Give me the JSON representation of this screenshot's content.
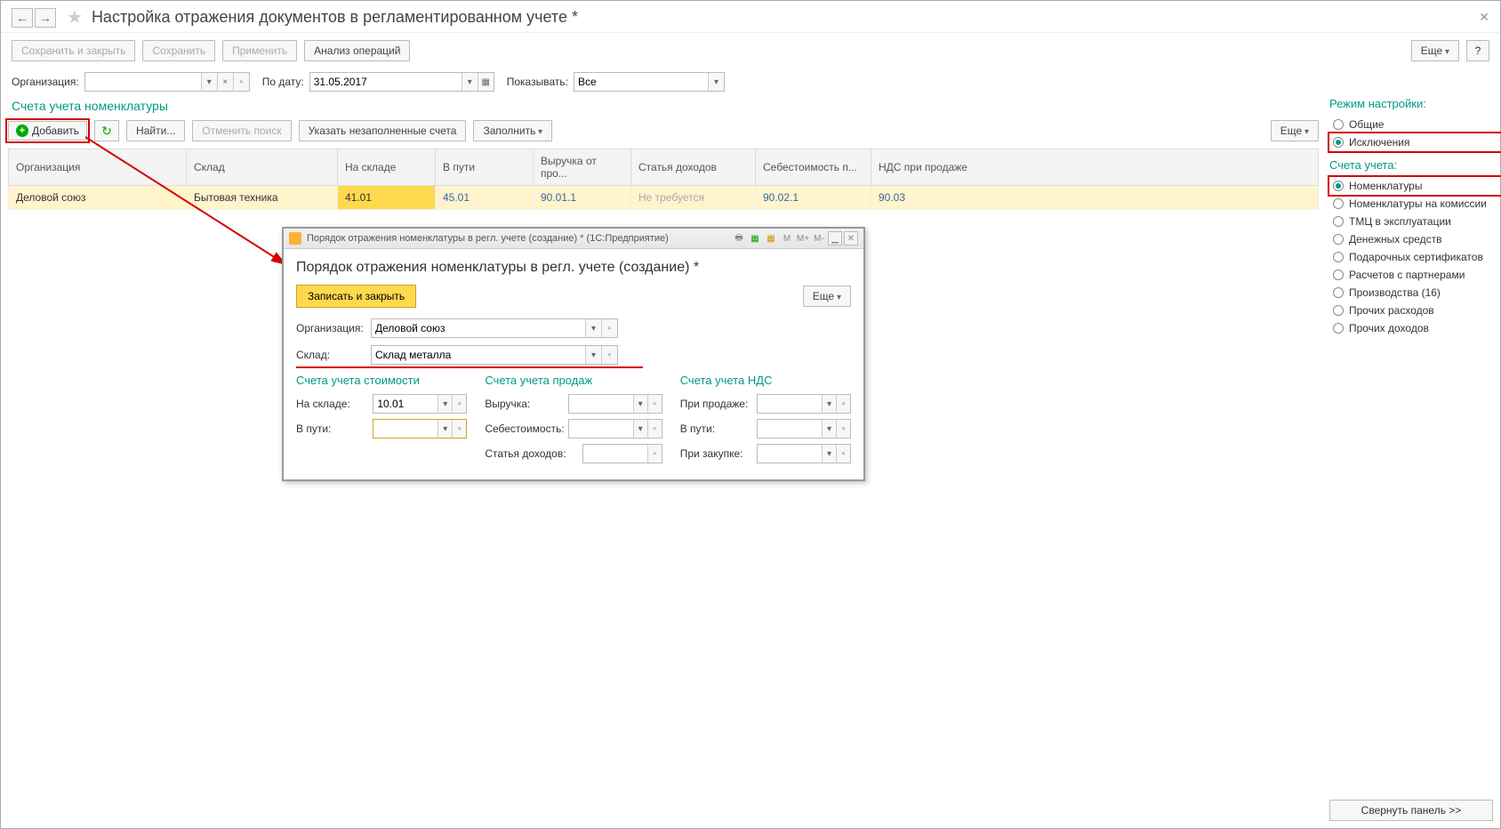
{
  "header": {
    "title": "Настройка отражения документов в регламентированном учете *"
  },
  "topToolbar": {
    "saveClose": "Сохранить и закрыть",
    "save": "Сохранить",
    "apply": "Применить",
    "analysis": "Анализ операций",
    "more": "Еще",
    "help": "?"
  },
  "filters": {
    "orgLabel": "Организация:",
    "orgValue": "",
    "dateLabel": "По дату:",
    "dateValue": "31.05.2017",
    "showLabel": "Показывать:",
    "showValue": "Все"
  },
  "section": {
    "title": "Счета учета номенклатуры",
    "add": "Добавить",
    "find": "Найти...",
    "cancelSearch": "Отменить поиск",
    "showEmpty": "Указать незаполненные счета",
    "fill": "Заполнить",
    "more": "Еще"
  },
  "table": {
    "headers": {
      "org": "Организация",
      "warehouse": "Склад",
      "atWarehouse": "На складе",
      "inTransit": "В пути",
      "revenue": "Выручка от про...",
      "incomeItem": "Статья доходов",
      "cost": "Себестоимость п...",
      "vat": "НДС при продаже"
    },
    "row": {
      "org": "Деловой союз",
      "warehouse": "Бытовая техника",
      "atWarehouse": "41.01",
      "inTransit": "45.01",
      "revenue": "90.01.1",
      "incomeItem": "Не требуется",
      "cost": "90.02.1",
      "vat": "90.03"
    }
  },
  "modal": {
    "titlebar": "Порядок отражения номенклатуры в регл. учете (создание) *  (1С:Предприятие)",
    "title": "Порядок отражения номенклатуры в регл. учете (создание) *",
    "writeClose": "Записать и закрыть",
    "more": "Еще",
    "orgLabel": "Организация:",
    "orgValue": "Деловой союз",
    "whLabel": "Склад:",
    "whValue": "Склад металла",
    "group1": "Счета учета стоимости",
    "g1_atWh": "На складе:",
    "g1_atWhVal": "10.01",
    "g1_transit": "В пути:",
    "group2": "Счета учета продаж",
    "g2_rev": "Выручка:",
    "g2_cost": "Себестоимость:",
    "g2_inc": "Статья доходов:",
    "group3": "Счета учета НДС",
    "g3_sale": "При продаже:",
    "g3_transit": "В пути:",
    "g3_purchase": "При закупке:"
  },
  "side": {
    "modeTitle": "Режим настройки:",
    "mode": {
      "common": "Общие",
      "exceptions": "Исключения"
    },
    "acctTitle": "Счета учета:",
    "accts": {
      "nomen": "Номенклатуры",
      "comm": "Номенклатуры на комиссии",
      "tmc": "ТМЦ в эксплуатации",
      "money": "Денежных средств",
      "gift": "Подарочных сертификатов",
      "partner": "Расчетов с партнерами",
      "prod": "Производства (16)",
      "expense": "Прочих расходов",
      "income": "Прочих доходов"
    },
    "collapse": "Свернуть панель >>"
  }
}
